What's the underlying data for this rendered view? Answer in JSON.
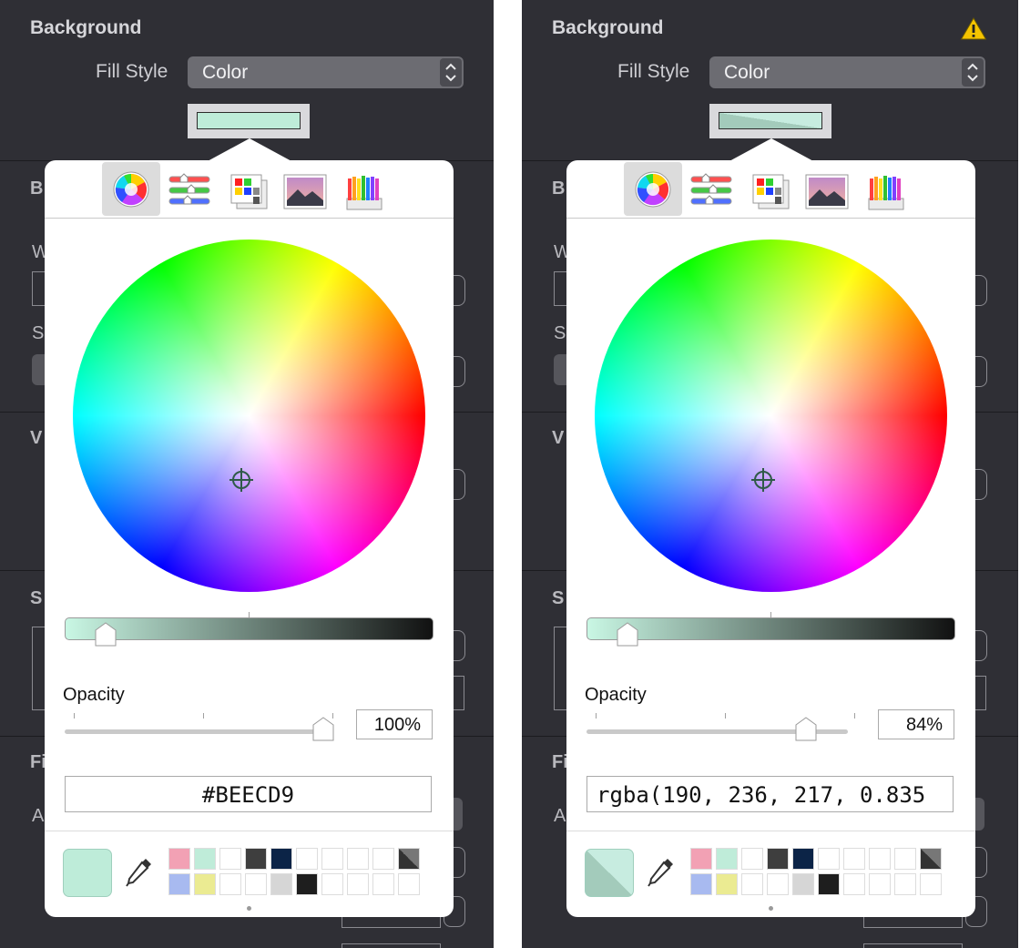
{
  "panels": [
    {
      "title": "Background",
      "has_warning": false,
      "fill_style_label": "Fill Style",
      "fill_style_value": "Color",
      "popover": {
        "tabs": [
          "color-wheel",
          "color-sliders",
          "color-palettes",
          "image-palettes",
          "pencils"
        ],
        "active_tab": "color-wheel",
        "opacity_label": "Opacity",
        "opacity_value": "100%",
        "opacity_fraction": 1.0,
        "brightness_fraction": 0.11,
        "color_code": "#BEECD9"
      },
      "current_color": "#BEECD9",
      "partially_hidden_labels": [
        "B",
        "W",
        "S",
        "V",
        "S",
        "Fi",
        "A"
      ]
    },
    {
      "title": "Background",
      "has_warning": true,
      "fill_style_label": "Fill Style",
      "fill_style_value": "Color",
      "popover": {
        "tabs": [
          "color-wheel",
          "color-sliders",
          "color-palettes",
          "image-palettes",
          "pencils"
        ],
        "active_tab": "color-wheel",
        "opacity_label": "Opacity",
        "opacity_value": "84%",
        "opacity_fraction": 0.84,
        "brightness_fraction": 0.11,
        "color_code": "rgba(190, 236, 217, 0.835"
      },
      "current_color": "#BEECD9",
      "partially_hidden_labels": [
        "B",
        "W",
        "S",
        "V",
        "S",
        "Fi",
        "A"
      ]
    }
  ],
  "colors": {
    "panel_bg": "#2f2f35",
    "accent_swatch": "#BEECD9",
    "warning": "#f5c400"
  },
  "swatch_grid": {
    "row1": [
      "#f2a1b4",
      "#bfecd9",
      "#ffffff",
      "#3e3e3e",
      "#0c2447",
      "#ffffff",
      "#ffffff",
      "#ffffff",
      "#ffffff",
      "#333333"
    ],
    "row2": [
      "#a8baf0",
      "#ebeb92",
      "#ffffff",
      "#ffffff",
      "#d6d6d6",
      "#1e1e1e",
      "#ffffff",
      "#ffffff",
      "#ffffff",
      "#ffffff"
    ]
  }
}
